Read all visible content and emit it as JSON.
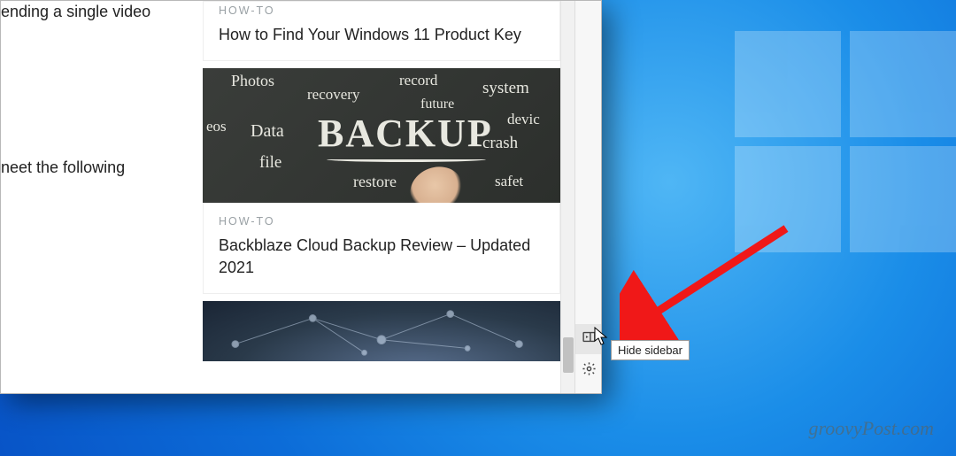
{
  "left_fragments": {
    "line1": "ending a single video",
    "line2": "neet the following"
  },
  "articles": [
    {
      "kicker": "HOW-TO",
      "headline": "How to Find Your Windows 11 Product Key"
    },
    {
      "kicker": "HOW-TO",
      "headline": "Backblaze Cloud Backup Review – Updated 2021",
      "thumb_words": {
        "main": "BACKUP",
        "others": [
          "Photos",
          "recovery",
          "record",
          "system",
          "future",
          "devic",
          "eos",
          "Data",
          "crash",
          "file",
          "restore",
          "safet"
        ]
      }
    }
  ],
  "sidebar": {
    "hide_tooltip": "Hide sidebar"
  },
  "watermark": "groovyPost.com",
  "icons": {
    "hide_sidebar": "hide-sidebar-icon",
    "settings": "gear-icon"
  }
}
